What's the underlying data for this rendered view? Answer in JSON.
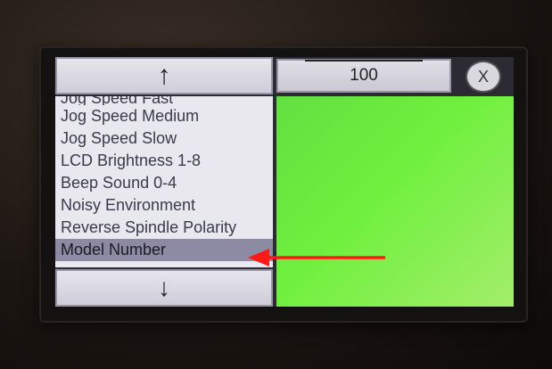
{
  "navigation": {
    "up_arrow": "↑",
    "down_arrow": "↓"
  },
  "value_display": "100",
  "close_button": "X",
  "menu": {
    "partial_top_item": "Jog Speed Fast",
    "items": [
      {
        "label": "Jog Speed Medium"
      },
      {
        "label": "Jog Speed Slow"
      },
      {
        "label": "LCD Brightness 1-8"
      },
      {
        "label": "Beep Sound 0-4"
      },
      {
        "label": "Noisy Environment"
      },
      {
        "label": "Reverse Spindle Polarity"
      },
      {
        "label": "Model Number"
      }
    ],
    "selected_index": 6
  },
  "colors": {
    "preview_panel": "#6ff03e",
    "annotation_arrow": "#ff1a1a",
    "selection": "#8d8ba3"
  }
}
